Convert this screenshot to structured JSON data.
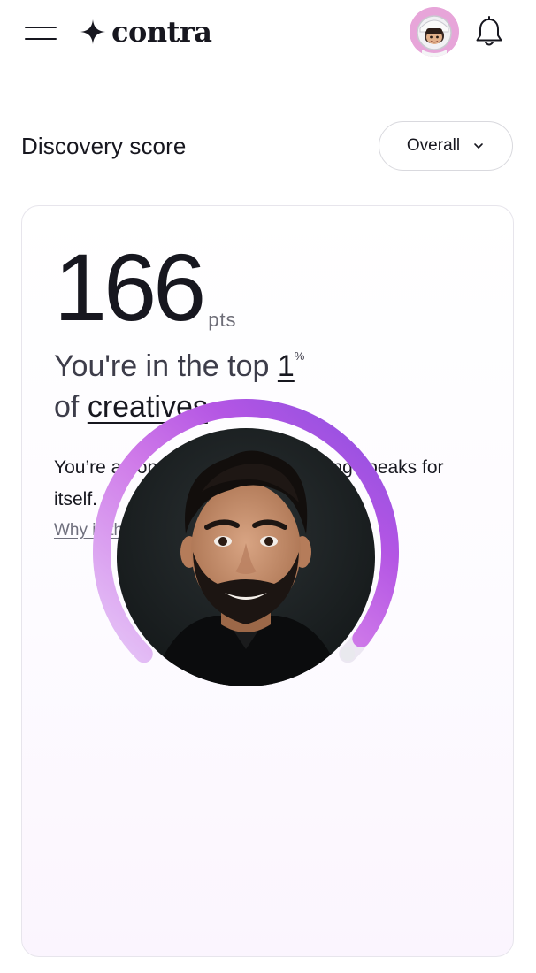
{
  "header": {
    "logo_text": "contra",
    "menu_icon": "hamburger-menu-icon",
    "logo_icon": "four-point-star-icon",
    "avatar_icon": "astronaut-avatar",
    "bell_icon": "bell-icon"
  },
  "section": {
    "title": "Discovery score",
    "filter_label": "Overall",
    "filter_icon": "chevron-down-icon"
  },
  "score": {
    "value": "166",
    "unit": "pts",
    "rank_prefix": "You're in the top ",
    "rank_number": "1",
    "rank_suffix": "%",
    "rank_of": "of ",
    "rank_group": "creatives",
    "description": "You’re among the best! Your ranking speaks for itself.",
    "why_link": "Why is this score important?",
    "gauge_progress": 0.97
  },
  "colors": {
    "accent_light": "#e3c2f6",
    "accent_mid": "#c25fe6",
    "accent_dark": "#8e4ee0",
    "text": "#17171f"
  }
}
